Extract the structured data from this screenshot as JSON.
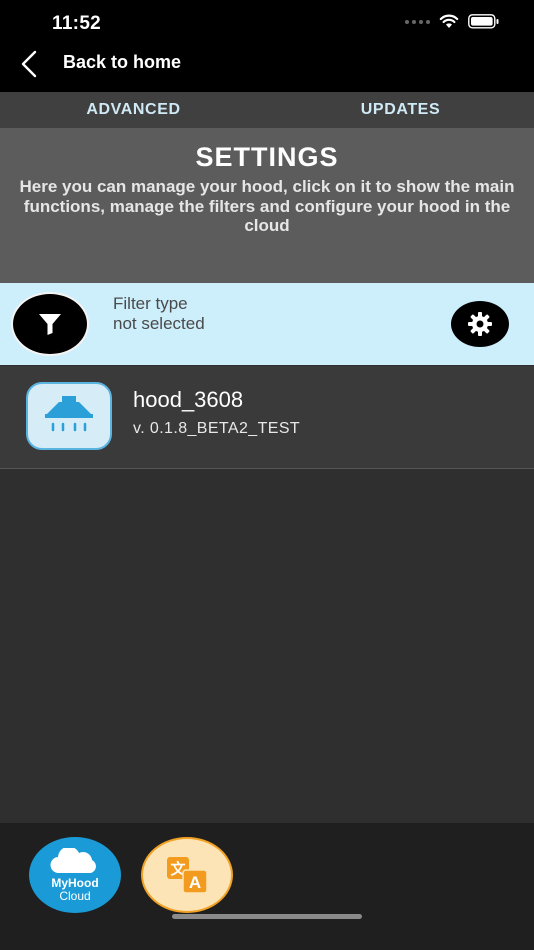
{
  "status_bar": {
    "time": "11:52"
  },
  "nav": {
    "back_label": "Back to home"
  },
  "tabs": [
    {
      "label": "ADVANCED"
    },
    {
      "label": "UPDATES"
    }
  ],
  "settings": {
    "title": "SETTINGS",
    "description": "Here you can manage your hood, click on it to show the main functions, manage the filters and configure your hood in the cloud"
  },
  "filter": {
    "label": "Filter type",
    "value": "not selected",
    "icon": "filter-icon",
    "settings_icon": "gear-icon"
  },
  "device": {
    "name": "hood_3608",
    "version": "v. 0.1.8_BETA2_TEST",
    "icon": "hood-icon"
  },
  "bottom": {
    "myhood_title": "MyHood",
    "myhood_sub": "Cloud",
    "language_icon": "translate-icon"
  },
  "colors": {
    "accent_blue": "#1a9ad6",
    "filter_row_bg": "#cdeefb",
    "tab_text": "#cfe9f5",
    "language_orange": "#f1a224"
  }
}
